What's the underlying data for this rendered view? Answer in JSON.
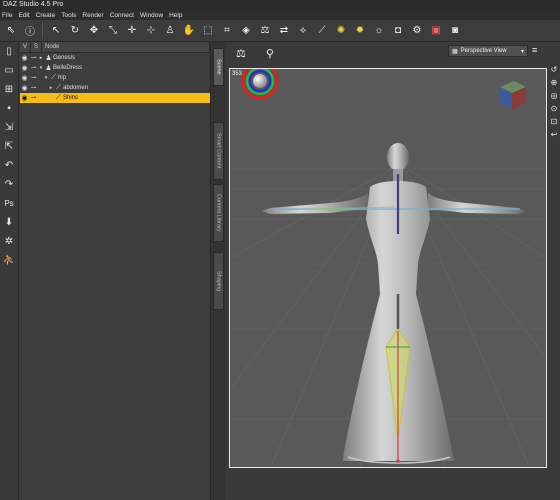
{
  "window": {
    "title": "DAZ Studio 4.5 Pro"
  },
  "menu": [
    {
      "label": "File"
    },
    {
      "label": "Edit"
    },
    {
      "label": "Create"
    },
    {
      "label": "Tools"
    },
    {
      "label": "Render"
    },
    {
      "label": "Connect"
    },
    {
      "label": "Window"
    },
    {
      "label": "Help"
    }
  ],
  "toolbar_icons": [
    "pointer-icon",
    "help-icon",
    "node-selection-icon",
    "rotate-icon",
    "translate-icon",
    "scale-icon",
    "universal-icon",
    "joint-editor-icon",
    "active-pose-icon",
    "region-navigator-icon",
    "surface-selection-icon",
    "spot-render-icon",
    "geometry-editor-icon",
    "node-weight-icon",
    "transfer-icon",
    "morph-icon",
    "bone-icon",
    "point-light-icon",
    "spot-light-icon",
    "distant-light-icon",
    "camera-icon",
    "render-settings-icon",
    "render-icon",
    "save-icon"
  ],
  "scene": {
    "columns": [
      "V",
      "S",
      "Node"
    ],
    "rows": [
      {
        "label": "Genesis",
        "indent": 0,
        "selected": false
      },
      {
        "label": "BelleDress",
        "indent": 0,
        "selected": false
      },
      {
        "label": "hip",
        "indent": 1,
        "selected": false
      },
      {
        "label": "abdomen",
        "indent": 2,
        "selected": false
      },
      {
        "label": "Shins",
        "indent": 2,
        "selected": true
      }
    ]
  },
  "side_tabs": [
    {
      "label": "Scene",
      "active": true
    },
    {
      "label": "Smart Content",
      "active": false
    },
    {
      "label": "Content Library",
      "active": false
    },
    {
      "label": "Shaping",
      "active": false
    }
  ],
  "viewport": {
    "view": "Perspective View",
    "corner_label": "353"
  },
  "colors": {
    "selection": "#f5bd16",
    "viewport_bg": "#595959",
    "panel_bg": "#3d3d3d"
  }
}
